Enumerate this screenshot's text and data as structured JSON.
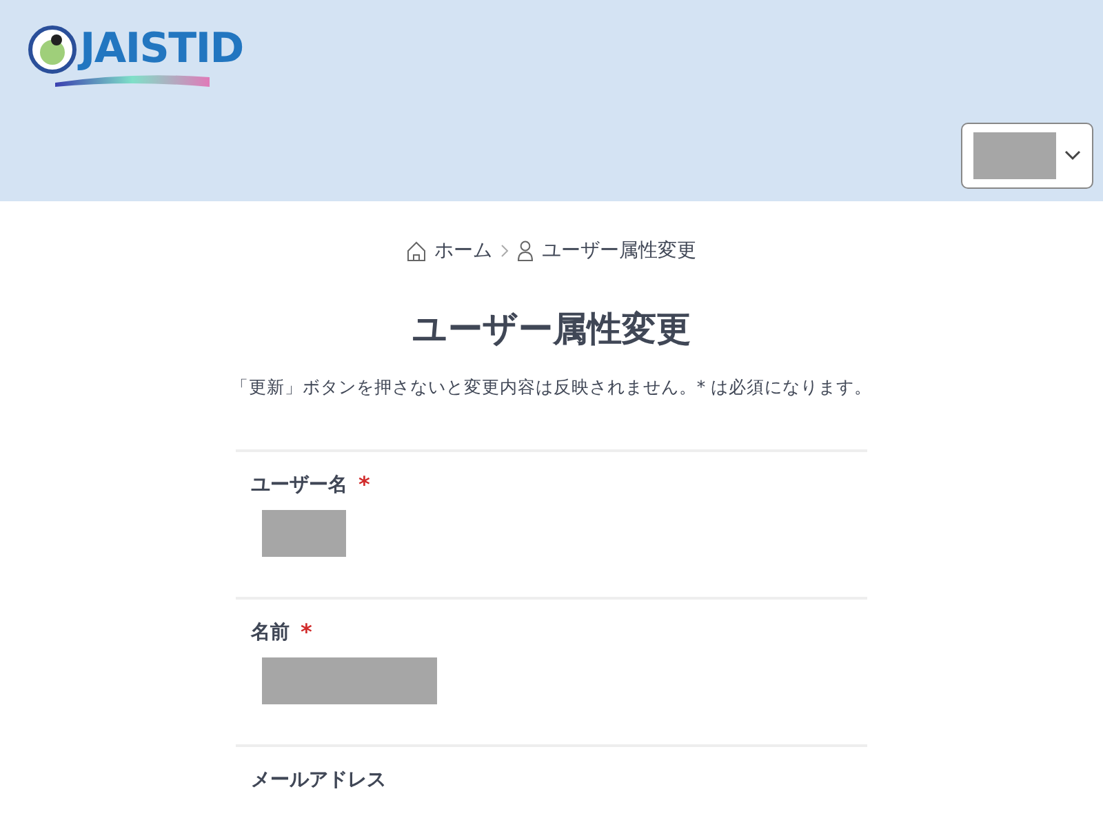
{
  "header": {
    "logo": {
      "text": "JAISTID"
    },
    "user_menu": {
      "value_redacted": true
    }
  },
  "breadcrumb": [
    {
      "label": "ホーム"
    },
    {
      "label": "ユーザー属性変更"
    }
  ],
  "title": "ユーザー属性変更",
  "note": "「更新」ボタンを押さないと変更内容は反映されません。* は必須になります。",
  "fields": [
    {
      "label": "ユーザー名",
      "required_mark": "*",
      "value_redacted": true
    },
    {
      "label": "名前",
      "required_mark": "*",
      "value_redacted": true
    },
    {
      "label": "メールアドレス"
    }
  ]
}
